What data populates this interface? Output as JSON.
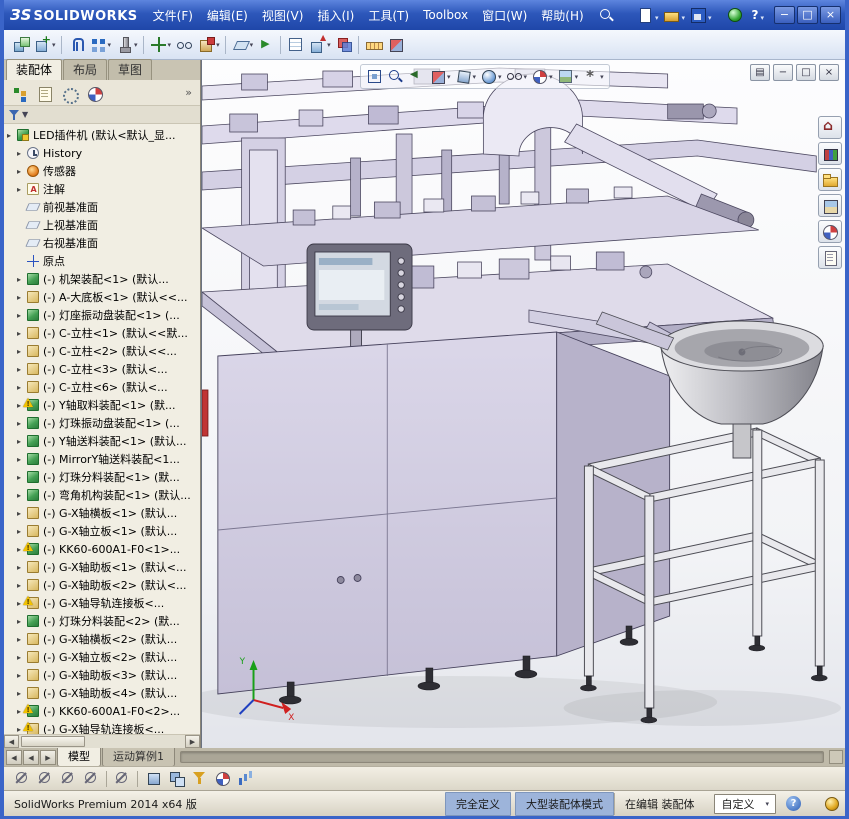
{
  "titlebar": {
    "logo_mark": "ЗS",
    "logo_text": "SOLIDWORKS",
    "menus": [
      "文件(F)",
      "编辑(E)",
      "视图(V)",
      "插入(I)",
      "工具(T)",
      "Toolbox",
      "窗口(W)",
      "帮助(H)"
    ],
    "quick_icons": [
      {
        "name": "new-document",
        "dropdown": true
      },
      {
        "name": "open-document",
        "dropdown": true
      },
      {
        "name": "save-document",
        "dropdown": true
      }
    ],
    "help_label": "?",
    "minimize_glyph": "−",
    "maximize_glyph": "□",
    "close_glyph": "×"
  },
  "toolbar": {
    "items": [
      {
        "name": "edit-component",
        "state": "disabled"
      },
      {
        "name": "insert-components",
        "dropdown": true
      },
      {
        "name": "sep"
      },
      {
        "name": "mate"
      },
      {
        "name": "component-pattern",
        "dropdown": true
      },
      {
        "name": "smart-fasteners",
        "dropdown": true
      },
      {
        "name": "sep"
      },
      {
        "name": "move-component",
        "dropdown": true
      },
      {
        "name": "show-hidden-components"
      },
      {
        "name": "assembly-features",
        "dropdown": true
      },
      {
        "name": "sep"
      },
      {
        "name": "reference-geometry",
        "dropdown": true
      },
      {
        "name": "new-motion-study"
      },
      {
        "name": "sep"
      },
      {
        "name": "bill-of-materials"
      },
      {
        "name": "exploded-view",
        "dropdown": true
      },
      {
        "name": "interference-detection",
        "state": "disabled"
      },
      {
        "name": "sep"
      },
      {
        "name": "measure"
      },
      {
        "name": "section-view"
      }
    ]
  },
  "panel": {
    "tabs": [
      {
        "label": "装配体",
        "state": "active"
      },
      {
        "label": "布局",
        "state": ""
      },
      {
        "label": "草图",
        "state": ""
      }
    ],
    "chevron": "»",
    "fm_icons": [
      {
        "name": "feature-tree"
      },
      {
        "name": "property-manager"
      },
      {
        "name": "configuration-manager"
      },
      {
        "name": "display-manager"
      }
    ],
    "tree": {
      "items": [
        {
          "label": "LED插件机 (默认<默认_显...",
          "icon": "root",
          "arrow": true
        },
        {
          "label": "History",
          "icon": "history",
          "arrow": true,
          "ind": "d1"
        },
        {
          "label": "传感器",
          "icon": "sensor",
          "arrow": true,
          "ind": "d1"
        },
        {
          "label": "注解",
          "icon": "note",
          "arrow": true,
          "ind": "d1"
        },
        {
          "label": "前视基准面",
          "icon": "plane",
          "ind": "d1"
        },
        {
          "label": "上视基准面",
          "icon": "plane",
          "ind": "d1"
        },
        {
          "label": "右视基准面",
          "icon": "plane",
          "ind": "d1"
        },
        {
          "label": "原点",
          "icon": "origin",
          "ind": "d1"
        },
        {
          "label": "(-) 机架装配<1> (默认...",
          "icon": "asm",
          "arrow": true,
          "ind": "d1"
        },
        {
          "label": "(-) A-大底板<1> (默认<<...",
          "icon": "part",
          "arrow": true,
          "ind": "d1"
        },
        {
          "label": "(-) 灯座振动盘装配<1> (...",
          "icon": "asm",
          "arrow": true,
          "ind": "d1"
        },
        {
          "label": "(-) C-立柱<1> (默认<<默...",
          "icon": "part",
          "arrow": true,
          "ind": "d1"
        },
        {
          "label": "(-) C-立柱<2> (默认<<...",
          "icon": "part",
          "arrow": true,
          "ind": "d1"
        },
        {
          "label": "(-) C-立柱<3> (默认<...",
          "icon": "part",
          "arrow": true,
          "ind": "d1"
        },
        {
          "label": "(-) C-立柱<6> (默认<...",
          "icon": "part",
          "arrow": true,
          "ind": "d1"
        },
        {
          "label": "(-) Y轴取料装配<1> (默...",
          "icon": "asm",
          "arrow": true,
          "warn": true,
          "ind": "d1"
        },
        {
          "label": "(-) 灯珠振动盘装配<1> (...",
          "icon": "asm",
          "arrow": true,
          "ind": "d1"
        },
        {
          "label": "(-) Y轴送料装配<1> (默认...",
          "icon": "asm",
          "arrow": true,
          "ind": "d1"
        },
        {
          "label": "(-) MirrorY轴送料装配<1...",
          "icon": "asm",
          "arrow": true,
          "ind": "d1"
        },
        {
          "label": "(-) 灯珠分料装配<1> (默...",
          "icon": "asm",
          "arrow": true,
          "ind": "d1"
        },
        {
          "label": "(-) 弯角机构装配<1> (默认...",
          "icon": "asm",
          "arrow": true,
          "ind": "d1"
        },
        {
          "label": "(-) G-X轴横板<1> (默认...",
          "icon": "part",
          "arrow": true,
          "ind": "d1"
        },
        {
          "label": "(-) G-X轴立板<1> (默认...",
          "icon": "part",
          "arrow": true,
          "ind": "d1"
        },
        {
          "label": "(-) KK60-600A1-F0<1>...",
          "icon": "asm",
          "arrow": true,
          "warn": true,
          "ind": "d1"
        },
        {
          "label": "(-) G-X轴助板<1> (默认<...",
          "icon": "part",
          "arrow": true,
          "ind": "d1"
        },
        {
          "label": "(-) G-X轴助板<2> (默认<...",
          "icon": "part",
          "arrow": true,
          "ind": "d1"
        },
        {
          "label": "(-) G-X轴导轨连接板<...",
          "icon": "part",
          "arrow": true,
          "warn": true,
          "ind": "d1"
        },
        {
          "label": "(-) 灯珠分料装配<2> (默...",
          "icon": "asm",
          "arrow": true,
          "ind": "d1"
        },
        {
          "label": "(-) G-X轴横板<2> (默认...",
          "icon": "part",
          "arrow": true,
          "ind": "d1"
        },
        {
          "label": "(-) G-X轴立板<2> (默认...",
          "icon": "part",
          "arrow": true,
          "ind": "d1"
        },
        {
          "label": "(-) G-X轴助板<3> (默认...",
          "icon": "part",
          "arrow": true,
          "ind": "d1"
        },
        {
          "label": "(-) G-X轴助板<4> (默认...",
          "icon": "part",
          "arrow": true,
          "ind": "d1"
        },
        {
          "label": "(-) KK60-600A1-F0<2>...",
          "icon": "asm",
          "arrow": true,
          "warn": true,
          "ind": "d1"
        },
        {
          "label": "(-) G-X轴导轨连接板<...",
          "icon": "part",
          "arrow": true,
          "warn": true,
          "ind": "d1"
        }
      ]
    }
  },
  "viewport": {
    "hud": [
      {
        "name": "zoom-fit"
      },
      {
        "name": "zoom-area"
      },
      {
        "name": "prev-view"
      },
      {
        "name": "section-view",
        "dropdown": true
      },
      {
        "name": "view-orientation",
        "dropdown": true
      },
      {
        "name": "display-style",
        "dropdown": true
      },
      {
        "name": "hide-show",
        "dropdown": true
      },
      {
        "name": "edit-appearance",
        "dropdown": true
      },
      {
        "name": "apply-scene",
        "dropdown": true
      },
      {
        "name": "view-settings",
        "dropdown": true
      }
    ],
    "window_controls": [
      {
        "name": "pane-toggle",
        "glyph": "▤"
      },
      {
        "name": "minimize",
        "glyph": "−"
      },
      {
        "name": "restore",
        "glyph": "□"
      },
      {
        "name": "close",
        "glyph": "×"
      }
    ],
    "task_pane": [
      {
        "name": "resources-home"
      },
      {
        "name": "design-library"
      },
      {
        "name": "file-explorer"
      },
      {
        "name": "view-palette"
      },
      {
        "name": "appearances-scenes"
      },
      {
        "name": "custom-properties"
      }
    ],
    "triad": {
      "x": "X",
      "y": "Y"
    }
  },
  "bottom": {
    "nav": [
      {
        "name": "tab-scroll-start",
        "glyph": "◀"
      },
      {
        "name": "tab-scroll-left",
        "glyph": "◀"
      },
      {
        "name": "tab-scroll-right",
        "glyph": "▶"
      }
    ],
    "tabs": [
      {
        "label": "模型",
        "state": "active"
      },
      {
        "label": "运动算例1",
        "state": ""
      }
    ]
  },
  "lower_toolbar": {
    "items": [
      {
        "name": "filter-vertices",
        "state": "disabled"
      },
      {
        "name": "filter-edges",
        "state": "disabled"
      },
      {
        "name": "filter-faces",
        "state": "disabled"
      },
      {
        "name": "filter-bodies",
        "state": "disabled"
      },
      {
        "name": "sep"
      },
      {
        "name": "magnetic-lines",
        "state": "disabled"
      },
      {
        "name": "sep"
      },
      {
        "name": "isolate"
      },
      {
        "name": "display-states"
      },
      {
        "name": "selection-filter"
      },
      {
        "name": "appearance-visualization"
      },
      {
        "name": "assembly-visualization"
      }
    ]
  },
  "statusbar": {
    "app_version": "SolidWorks Premium 2014 x64 版",
    "define_state": "完全定义",
    "assembly_mode": "大型装配体模式",
    "editing": "在编辑 装配体",
    "custom_label": "自定义",
    "help_label": "?"
  },
  "colors": {
    "titlebar_blue": "#2d57ba",
    "status_blue": "#9db4da",
    "warning_yellow": "#f2c200",
    "model_lavender": "#cdc8de"
  }
}
